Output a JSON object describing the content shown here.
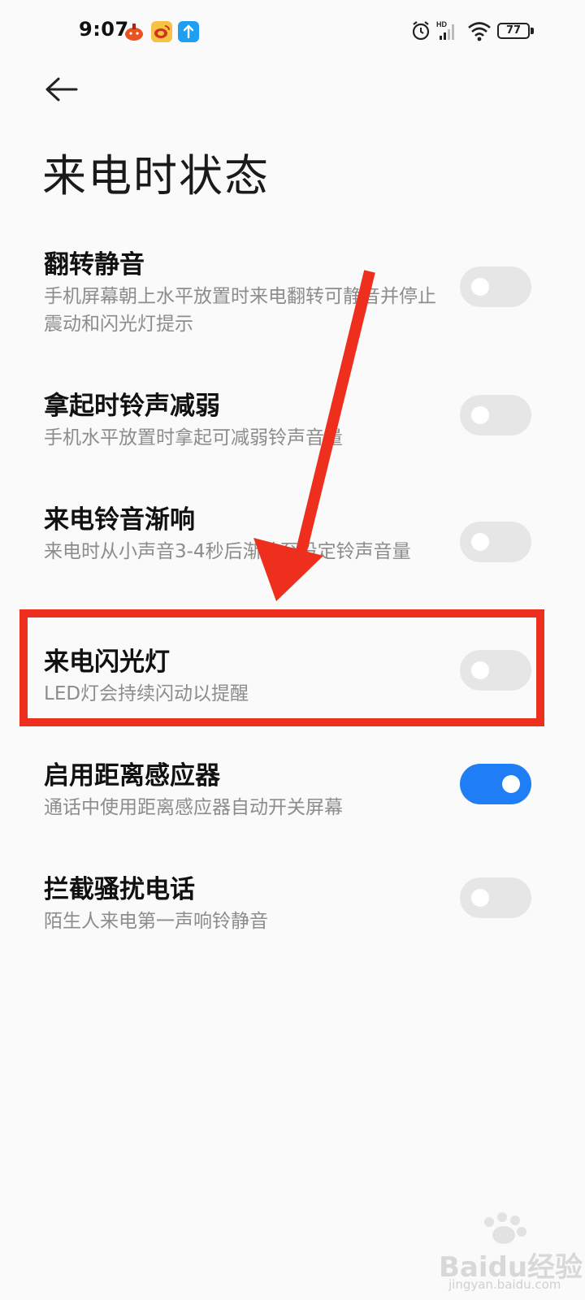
{
  "status_bar": {
    "time": "9:07",
    "battery": "77",
    "network_label": "HD"
  },
  "page": {
    "title": "来电时状态"
  },
  "settings": [
    {
      "title": "翻转静音",
      "desc": "手机屏幕朝上水平放置时来电翻转可静音并停止震动和闪光灯提示",
      "enabled": false
    },
    {
      "title": "拿起时铃声减弱",
      "desc": "手机水平放置时拿起可减弱铃声音量",
      "enabled": false
    },
    {
      "title": "来电铃音渐响",
      "desc": "来电时从小声音3-4秒后渐响至设定铃声音量",
      "enabled": false
    },
    {
      "title": "来电闪光灯",
      "desc": "LED灯会持续闪动以提醒",
      "enabled": false
    },
    {
      "title": "启用距离感应器",
      "desc": "通话中使用距离感应器自动开关屏幕",
      "enabled": true
    },
    {
      "title": "拦截骚扰电话",
      "desc": "陌生人来电第一声响铃静音",
      "enabled": false
    }
  ],
  "watermark": {
    "brand": "Baidu经验",
    "url": "jingyan.baidu.com"
  },
  "colors": {
    "accent": "#1f7ef5",
    "annotation": "#ef2f1d",
    "toggle_off": "#e6e6e6"
  }
}
